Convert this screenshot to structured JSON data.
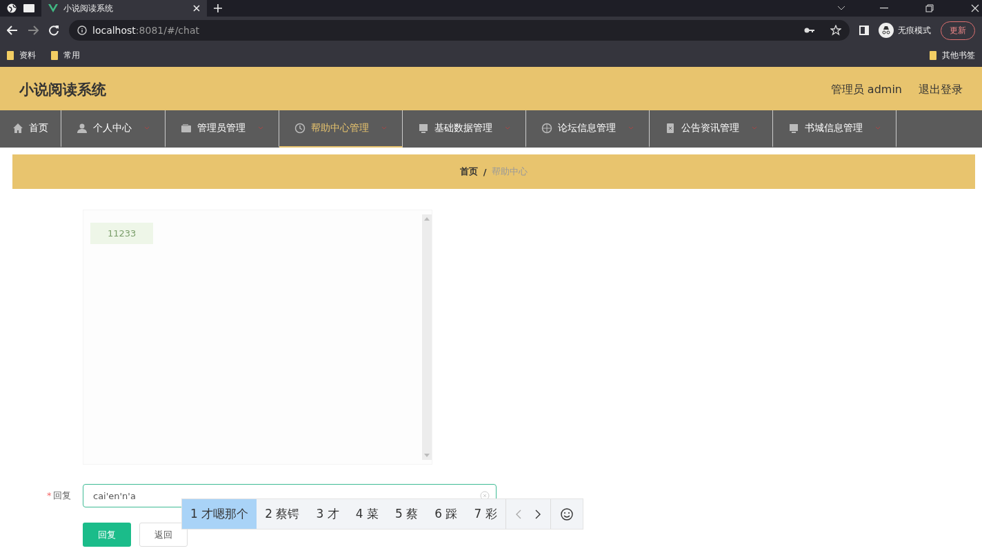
{
  "browser": {
    "tabs": [
      {
        "title": "小说阅读系统",
        "selected": true
      }
    ],
    "url_host": "localhost",
    "url_rest": ":8081/#/chat",
    "profile": "无痕模式",
    "update_button": "更新",
    "bookmarks": [
      "资料",
      "常用"
    ],
    "other_bookmarks": "其他书签"
  },
  "header": {
    "title": "小说阅读系统",
    "user": "管理员 admin",
    "logout": "退出登录"
  },
  "nav": [
    {
      "label": "首页",
      "dropdown": false,
      "selected": false
    },
    {
      "label": "个人中心",
      "dropdown": true,
      "selected": false
    },
    {
      "label": "管理员管理",
      "dropdown": true,
      "selected": false
    },
    {
      "label": "帮助中心管理",
      "dropdown": true,
      "selected": true
    },
    {
      "label": "基础数据管理",
      "dropdown": true,
      "selected": false
    },
    {
      "label": "论坛信息管理",
      "dropdown": true,
      "selected": false
    },
    {
      "label": "公告资讯管理",
      "dropdown": true,
      "selected": false
    },
    {
      "label": "书城信息管理",
      "dropdown": true,
      "selected": false
    }
  ],
  "breadcrumb": {
    "items": [
      "首页",
      "帮助中心"
    ],
    "separator": "/"
  },
  "chat": {
    "messages": [
      "11233"
    ]
  },
  "form": {
    "label": "回复",
    "required_mark": "*",
    "value": "cai'en'n'a",
    "submit": "回复",
    "back": "返回"
  },
  "ime_candidates": [
    {
      "label": "1 才嗯那个",
      "selected": true
    },
    {
      "label": "2 蔡锷",
      "selected": false
    },
    {
      "label": "3 才",
      "selected": false
    },
    {
      "label": "4 菜",
      "selected": false
    },
    {
      "label": "5 蔡",
      "selected": false
    },
    {
      "label": "6 踩",
      "selected": false
    },
    {
      "label": "7 彩",
      "selected": false
    }
  ]
}
